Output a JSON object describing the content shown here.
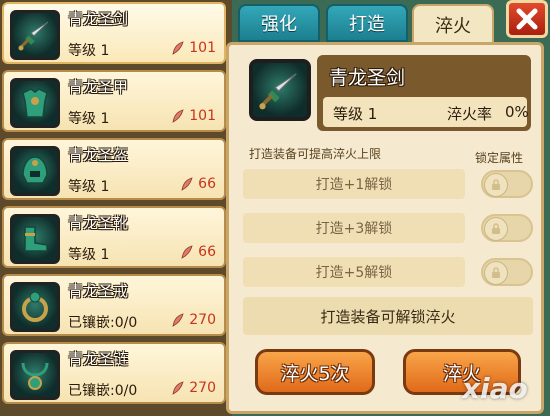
{
  "equipment_list": [
    {
      "name": "青龙圣剑",
      "stat": "等级 1",
      "cost": "101",
      "icon": "sword-icon"
    },
    {
      "name": "青龙圣甲",
      "stat": "等级 1",
      "cost": "101",
      "icon": "armor-icon"
    },
    {
      "name": "青龙圣盔",
      "stat": "等级 1",
      "cost": "66",
      "icon": "helmet-icon"
    },
    {
      "name": "青龙圣靴",
      "stat": "等级 1",
      "cost": "66",
      "icon": "boots-icon"
    },
    {
      "name": "青龙圣戒",
      "stat": "已镶嵌:0/0",
      "cost": "270",
      "icon": "ring-icon"
    },
    {
      "name": "青龙圣链",
      "stat": "已镶嵌:0/0",
      "cost": "270",
      "icon": "necklace-icon"
    }
  ],
  "tabs": [
    {
      "label": "强化"
    },
    {
      "label": "打造"
    },
    {
      "label": "淬火"
    }
  ],
  "active_tab": "淬火",
  "detail": {
    "name": "青龙圣剑",
    "level": "等级 1",
    "rate_label": "淬火率",
    "rate_value": "0%"
  },
  "hint": "打造装备可提高淬火上限",
  "lock_title": "锁定属性",
  "unlock_rows": [
    {
      "label": "打造+1解锁"
    },
    {
      "label": "打造+3解锁"
    },
    {
      "label": "打造+5解锁"
    }
  ],
  "notice": "打造装备可解锁淬火",
  "buttons": {
    "quench_five": "淬火5次",
    "quench": "淬火"
  },
  "watermark": "xiao",
  "colors": {
    "accent_orange": "#e8792a",
    "tab_teal": "#2996a7",
    "cost_red": "#c8341a",
    "close_red": "#c8341a"
  }
}
